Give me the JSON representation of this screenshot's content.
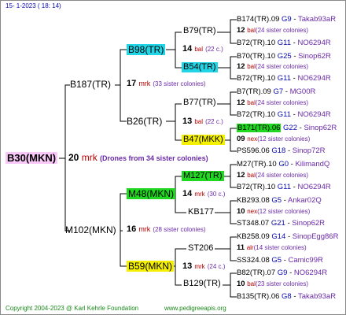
{
  "header": {
    "date_line": "15-    1-2023 ( 18: 14)"
  },
  "root": {
    "name": "B30(MKN)",
    "num": "20",
    "group": "mrk",
    "note": "(Drones from 34 sister colonies)"
  },
  "left": {
    "top": {
      "name": "B187(TR)",
      "num": "17",
      "group": "mrk",
      "note": "(33 sister colonies)"
    },
    "bottom": {
      "name": "M102(MKN)",
      "num": "16",
      "group": "mrk",
      "note": "(28 sister colonies)"
    }
  },
  "mid": [
    {
      "name": "B98(TR)",
      "num": "14",
      "group": "bal",
      "note": "(22 c.)"
    },
    {
      "name": "B26(TR)",
      "num": "13",
      "group": "bal",
      "note": "(22 c.)"
    },
    {
      "name": "M48(MKN)",
      "num": "14",
      "group": "mrk",
      "note": "(30 c.)"
    },
    {
      "name": "B59(MKN)",
      "num": "13",
      "group": "mrk",
      "note": "(24 c.)"
    }
  ],
  "gen3": [
    {
      "name": "B79(TR)"
    },
    {
      "name": "B54(TR)"
    },
    {
      "name": "B77(TR)"
    },
    {
      "name": "B47(MKK)"
    },
    {
      "name": "M127(TR)"
    },
    {
      "name": "KB177"
    },
    {
      "name": "ST206"
    },
    {
      "name": "B129(TR)"
    }
  ],
  "gen3_mid": [
    {
      "num": "12",
      "group": "bal",
      "note": "(24 sister colonies)"
    },
    {
      "num": "12",
      "group": "bal",
      "note": "(24 sister colonies)"
    },
    {
      "num": "12",
      "group": "bal",
      "note": "(24 sister colonies)"
    },
    {
      "num": "09",
      "group": "nex",
      "note": "(12 sister colonies)"
    },
    {
      "num": "12",
      "group": "bal",
      "note": "(24 sister colonies)"
    },
    {
      "num": "10",
      "group": "nex",
      "note": "(12 sister colonies)"
    },
    {
      "num": "11",
      "group": "alr",
      "note": "(14 sister colonies)"
    },
    {
      "num": "10",
      "group": "bal",
      "note": "(23 sister colonies)"
    }
  ],
  "gen4": [
    {
      "name": "B174(TR).09",
      "code": "G9",
      "label": "Takab93aR"
    },
    {
      "name": "B72(TR).10",
      "code": "G11",
      "label": "NO6294R"
    },
    {
      "name": "B70(TR).10",
      "code": "G25",
      "label": "Sinop62R"
    },
    {
      "name": "B72(TR).10",
      "code": "G11",
      "label": "NO6294R"
    },
    {
      "name": "B7(TR).09",
      "code": "G7",
      "label": "MG00R"
    },
    {
      "name": "B72(TR).10",
      "code": "G11",
      "label": "NO6294R"
    },
    {
      "name": "B171(TR).06",
      "code": "G22",
      "label": "Sinop62R"
    },
    {
      "name": "PS596.06",
      "code": "G18",
      "label": "Sinop72R"
    },
    {
      "name": "M27(TR).10",
      "code": "G0",
      "label": "KilimandQ"
    },
    {
      "name": "B72(TR).10",
      "code": "G11",
      "label": "NO6294R"
    },
    {
      "name": "KB293.08",
      "code": "G5",
      "label": "Ankar02Q"
    },
    {
      "name": "ST348.07",
      "code": "G21",
      "label": "Sinop62R"
    },
    {
      "name": "KB258.09",
      "code": "G14",
      "label": "SinopEgg86R"
    },
    {
      "name": "SS324.08",
      "code": "G5",
      "label": "Camic99R"
    },
    {
      "name": "B82(TR).07",
      "code": "G9",
      "label": "NO6294R"
    },
    {
      "name": "B135(TR).06",
      "code": "G8",
      "label": "Takab93aR"
    }
  ],
  "footer": {
    "copyright": "Copyright 2004-2023 @ Karl Kehrle Foundation",
    "site": "www.pedigreeapis.org"
  }
}
